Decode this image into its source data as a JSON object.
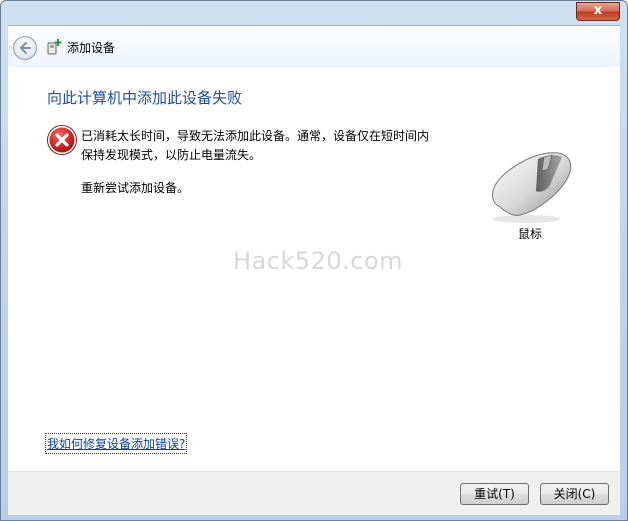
{
  "window": {
    "close_glyph": "x"
  },
  "nav": {
    "title": "添加设备",
    "back_icon": "back-arrow-icon",
    "title_icon": "add-device-icon"
  },
  "main": {
    "title": "向此计算机中添加此设备失败",
    "error_icon": "error-x-icon",
    "message_line1": "已消耗太长时间，导致无法添加此设备。通常，设备仅在短时间内",
    "message_line2": "保持发现模式，以防止电量流失。",
    "retry_prompt": "重新尝试添加设备。",
    "device_icon": "mouse-icon",
    "device_label": "鼠标",
    "watermark": "Hack520.com",
    "help_link": "我如何修复设备添加错误?"
  },
  "footer": {
    "retry_button": "重试(T)",
    "close_button": "关闭(C)"
  },
  "colors": {
    "title_blue": "#1e4fa0",
    "link_blue": "#0a3f9e",
    "error_red": "#c8202a"
  }
}
